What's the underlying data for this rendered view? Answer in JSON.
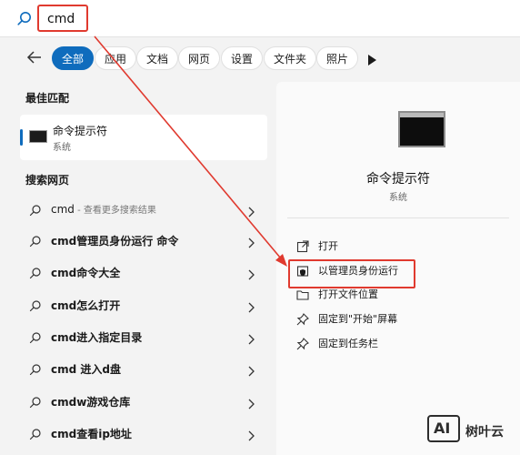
{
  "search": {
    "value": "cmd"
  },
  "filters": [
    "全部",
    "应用",
    "文档",
    "网页",
    "设置",
    "文件夹",
    "照片"
  ],
  "sections": {
    "best_match": "最佳匹配",
    "web_search": "搜索网页"
  },
  "best_match": {
    "title": "命令提示符",
    "subtitle": "系统"
  },
  "web_results": [
    {
      "text": "cmd",
      "hint": " - 查看更多搜索结果",
      "bold": false
    },
    {
      "text": "cmd管理员身份运行 命令",
      "hint": "",
      "bold": true
    },
    {
      "text": "cmd命令大全",
      "hint": "",
      "bold": true
    },
    {
      "text": "cmd怎么打开",
      "hint": "",
      "bold": true
    },
    {
      "text": "cmd进入指定目录",
      "hint": "",
      "bold": true
    },
    {
      "text": "cmd 进入d盘",
      "hint": "",
      "bold": true
    },
    {
      "text": "cmdw游戏仓库",
      "hint": "",
      "bold": true
    },
    {
      "text": "cmd查看ip地址",
      "hint": "",
      "bold": true
    }
  ],
  "details": {
    "title": "命令提示符",
    "subtitle": "系统",
    "actions": [
      {
        "label": "打开",
        "icon": "open-icon"
      },
      {
        "label": "以管理员身份运行",
        "icon": "shield-icon"
      },
      {
        "label": "打开文件位置",
        "icon": "folder-icon"
      },
      {
        "label": "固定到\"开始\"屏幕",
        "icon": "pin-icon"
      },
      {
        "label": "固定到任务栏",
        "icon": "pin-icon"
      }
    ]
  },
  "watermark": {
    "logo": "AI",
    "text": "树叶云"
  },
  "colors": {
    "accent": "#0f6cbd",
    "annotation": "#e03a2f"
  }
}
